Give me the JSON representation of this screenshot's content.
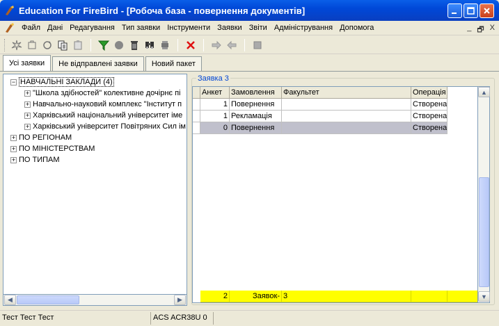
{
  "window": {
    "title": "Education For FireBird - [Робоча база - повернення документів]"
  },
  "menu": {
    "items": [
      "Файл",
      "Дані",
      "Редагування",
      "Тип заявки",
      "Інструменти",
      "Заявки",
      "Звіти",
      "Адміністрування",
      "Допомога"
    ],
    "mdi_min": "_",
    "mdi_restore": "🗗",
    "mdi_close": "X"
  },
  "toolbar": {
    "icons": [
      "new-icon",
      "open-icon",
      "refresh-icon",
      "copy-icon",
      "paste-icon",
      "filter-icon",
      "record-icon",
      "delete-icon",
      "find-icon",
      "print-icon",
      "cancel-icon",
      "send-icon",
      "receive-icon",
      "stop-icon"
    ]
  },
  "tabs": [
    "Усі заявки",
    "Не відправлені заявки",
    "Новий пакет"
  ],
  "tree": {
    "root": "НАВЧАЛЬНІ ЗАКЛАДИ (4)",
    "children": [
      "\"Школа здібностей\" колективне дочірнє пі",
      "Навчально-науковий комплекс \"Інститут п",
      "Харківський національний університет іме",
      "Харківський університет Повітряних Сил ім"
    ],
    "groups": [
      "ПО РЕГІОНАМ",
      "ПО МІНІСТЕРСТВАМ",
      "ПО ТИПАМ"
    ]
  },
  "group": {
    "legend": "Заявка 3"
  },
  "grid": {
    "headers": [
      "Анкет",
      "Замовлення",
      "Факультет",
      "Операція"
    ],
    "rows": [
      {
        "ank": "1",
        "zam": "Повернення",
        "fak": "",
        "op": "Створена"
      },
      {
        "ank": "1",
        "zam": "Рекламація",
        "fak": "",
        "op": "Створена"
      },
      {
        "ank": "0",
        "zam": "Повернення",
        "fak": "",
        "op": "Створена"
      }
    ],
    "footer": {
      "ank": "2",
      "zam": "Заявок-",
      "fak": "3"
    }
  },
  "status": {
    "user": "Тест Тест Тест",
    "reader": "ACS ACR38U 0"
  }
}
